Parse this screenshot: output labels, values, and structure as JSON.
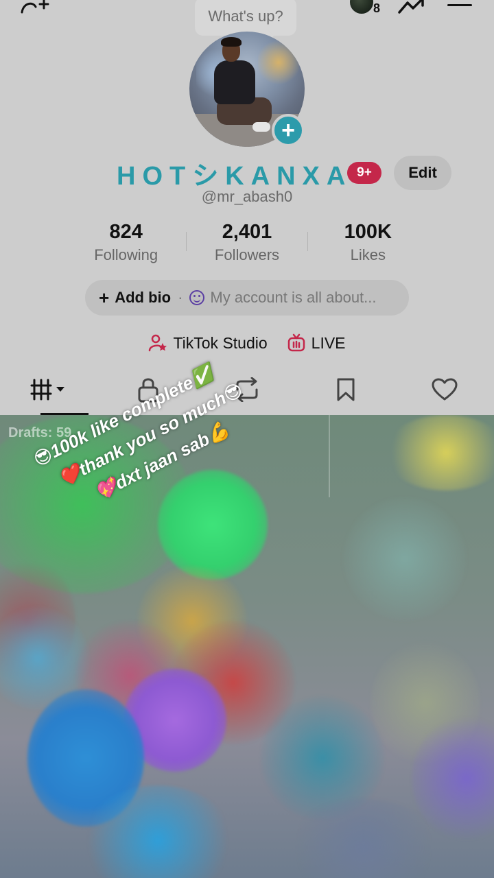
{
  "status_bubble": {
    "text": "What's up?"
  },
  "story": {
    "count": "8"
  },
  "profile": {
    "display_name": "HOTシKANXA",
    "notification_badge": "9+",
    "edit_label": "Edit",
    "username": "@mr_abash0"
  },
  "stats": [
    {
      "value": "824",
      "label": "Following"
    },
    {
      "value": "2,401",
      "label": "Followers"
    },
    {
      "value": "100K",
      "label": "Likes"
    }
  ],
  "bio": {
    "add_label": "Add bio",
    "separator": "·",
    "placeholder": "My account is all about..."
  },
  "links": {
    "studio_label": "TikTok Studio",
    "live_label": "LIVE"
  },
  "tabs": [
    {
      "name": "videos",
      "icon": "grid-icon"
    },
    {
      "name": "private",
      "icon": "lock-icon"
    },
    {
      "name": "reposts",
      "icon": "repost-icon"
    },
    {
      "name": "favorites",
      "icon": "bookmark-icon"
    },
    {
      "name": "liked",
      "icon": "heart-icon"
    }
  ],
  "grid": {
    "drafts_label": "Drafts: 59"
  },
  "overlay": {
    "line1": "😎100k like complete✅",
    "line2": "❤️thank you so much😎",
    "line3": "💖dxt jaan sab💪"
  },
  "colors": {
    "accent_name": "#2a9aa8",
    "badge": "#c4274a",
    "live": "#c4274a",
    "bio_icon": "#5b3fa3"
  }
}
